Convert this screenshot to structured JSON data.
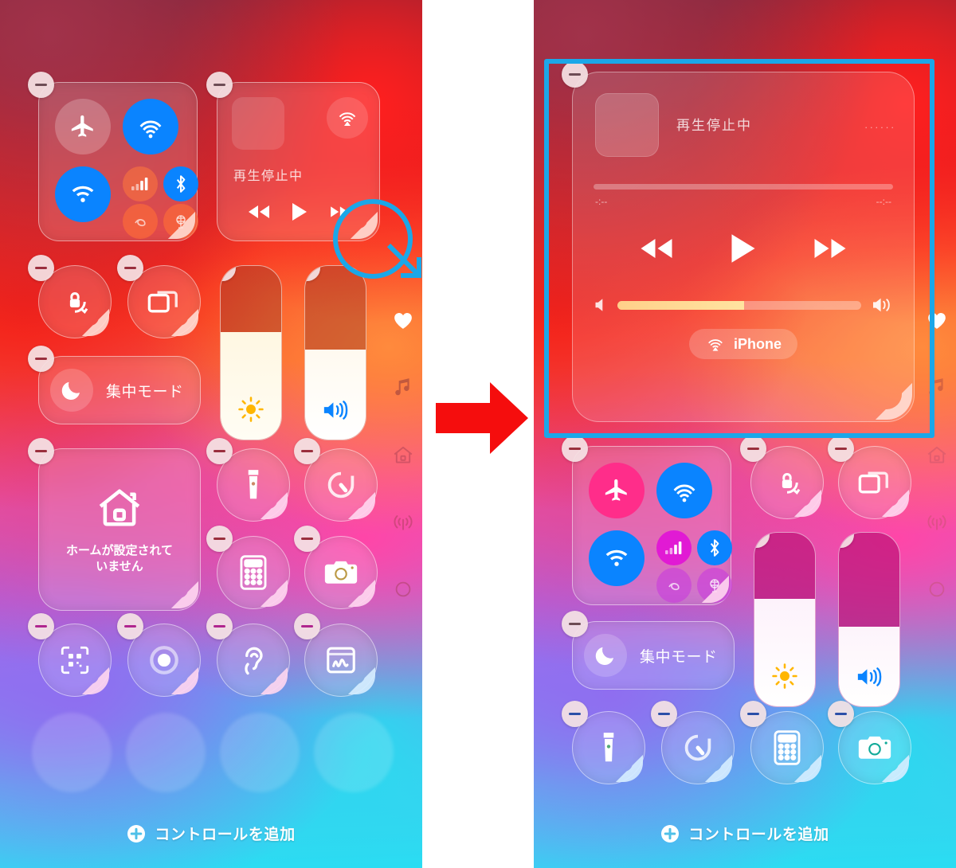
{
  "meta": {
    "app": "iOS Control Center — customize mode",
    "language": "ja",
    "panel_count": 2
  },
  "annotations": {
    "arrow_color": "#f50d0d",
    "highlight_color": "#1ba7e8",
    "left_highlight_target": "resize-grip-handle",
    "right_selection_target": "media-widget-expanded"
  },
  "left_panel": {
    "label": "before",
    "connectivity": {
      "name": "connectivity-module",
      "buttons": [
        {
          "name": "airplane-mode",
          "state": "off"
        },
        {
          "name": "airdrop",
          "state": "on"
        },
        {
          "name": "wifi",
          "state": "on"
        },
        {
          "name": "cellular-data",
          "state": "off"
        },
        {
          "name": "bluetooth",
          "state": "on"
        },
        {
          "name": "personal-hotspot",
          "state": "off"
        },
        {
          "name": "vpn",
          "state": "off"
        }
      ]
    },
    "media": {
      "name": "media-widget-small",
      "now_playing": "再生停止中",
      "controls": [
        "rewind",
        "play",
        "fast-forward"
      ],
      "airplay": "airplay-icon"
    },
    "toggles": [
      {
        "name": "rotation-lock",
        "label": ""
      },
      {
        "name": "screen-mirroring",
        "label": ""
      }
    ],
    "focus": {
      "name": "focus-mode",
      "label": "集中モード"
    },
    "brightness": {
      "name": "brightness-slider",
      "value": 62
    },
    "volume": {
      "name": "volume-slider",
      "value": 52
    },
    "home_widget": {
      "name": "home-widget",
      "line1": "ホームが設定されて",
      "line2": "いません"
    },
    "utilities": [
      {
        "name": "flashlight"
      },
      {
        "name": "timer"
      },
      {
        "name": "calculator"
      },
      {
        "name": "camera"
      }
    ],
    "accessibility_row": [
      {
        "name": "qr-code-scanner"
      },
      {
        "name": "screen-recording"
      },
      {
        "name": "hearing"
      },
      {
        "name": "notes"
      }
    ],
    "edge_icons": [
      {
        "name": "favorites-heart-icon",
        "active": true
      },
      {
        "name": "music-note-icon",
        "active": false
      },
      {
        "name": "home-icon",
        "active": false
      },
      {
        "name": "connectivity-icon",
        "active": false
      },
      {
        "name": "circle-icon",
        "active": false
      }
    ],
    "add_control": {
      "label": "コントロールを追加",
      "icon": "plus-circle-icon"
    }
  },
  "right_panel": {
    "label": "after",
    "media": {
      "name": "media-widget-expanded",
      "now_playing": "再生停止中",
      "overflow_dots": "......",
      "time_elapsed": "-:--",
      "time_remaining": "--:--",
      "scrub_value": 0,
      "controls": [
        "rewind",
        "play",
        "fast-forward"
      ],
      "volume_value": 52,
      "airplay_device": "iPhone",
      "airplay_icon": "airplay-audio-icon"
    },
    "connectivity": {
      "name": "connectivity-module",
      "buttons": [
        {
          "name": "airplane-mode",
          "state": "off"
        },
        {
          "name": "airdrop",
          "state": "on"
        },
        {
          "name": "wifi",
          "state": "on"
        },
        {
          "name": "cellular-data",
          "state": "off"
        },
        {
          "name": "bluetooth",
          "state": "on"
        },
        {
          "name": "personal-hotspot",
          "state": "off"
        },
        {
          "name": "vpn",
          "state": "off"
        }
      ]
    },
    "toggles": [
      {
        "name": "rotation-lock"
      },
      {
        "name": "screen-mirroring"
      }
    ],
    "focus": {
      "name": "focus-mode",
      "label": "集中モード"
    },
    "brightness": {
      "name": "brightness-slider",
      "value": 62
    },
    "volume": {
      "name": "volume-slider",
      "value": 46
    },
    "utilities": [
      {
        "name": "flashlight"
      },
      {
        "name": "timer"
      },
      {
        "name": "calculator"
      },
      {
        "name": "camera"
      }
    ],
    "edge_icons": [
      {
        "name": "favorites-heart-icon",
        "active": true
      },
      {
        "name": "music-note-icon",
        "active": false
      },
      {
        "name": "home-icon",
        "active": false
      },
      {
        "name": "connectivity-icon",
        "active": false
      },
      {
        "name": "circle-icon",
        "active": false
      }
    ],
    "add_control": {
      "label": "コントロールを追加",
      "icon": "plus-circle-icon"
    }
  }
}
